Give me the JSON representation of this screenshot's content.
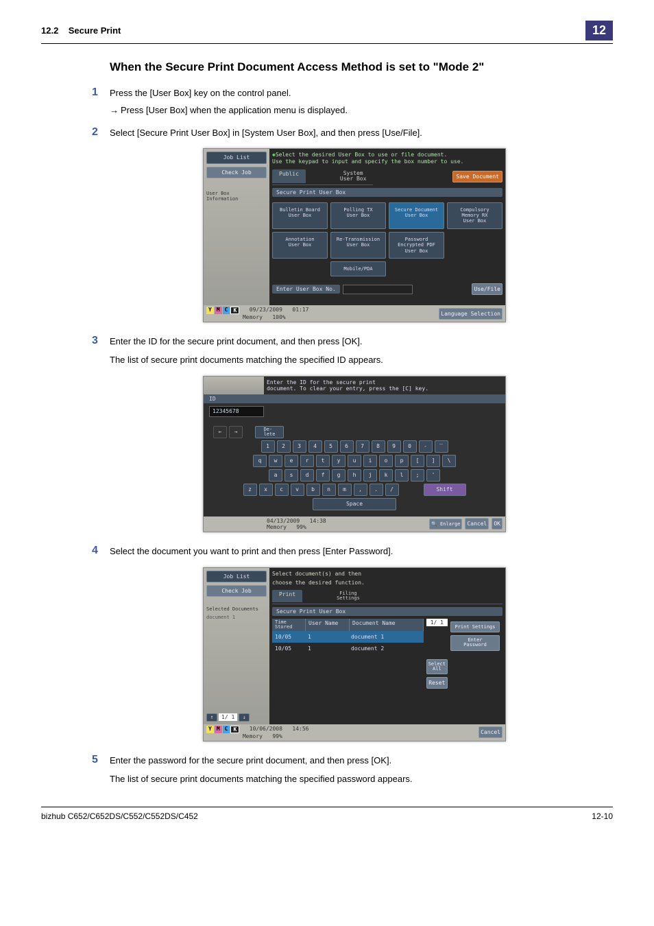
{
  "header": {
    "section_ref": "12.2",
    "section_title": "Secure Print",
    "chapter": "12"
  },
  "title": "When the Secure Print Document Access Method is set to \"Mode 2\"",
  "steps": {
    "s1": {
      "num": "1",
      "text": "Press the [User Box] key on the control panel.",
      "sub_arrow": "→",
      "sub": "Press [User Box] when the application menu is displayed."
    },
    "s2": {
      "num": "2",
      "text": "Select [Secure Print User Box] in [System User Box], and then press [Use/File]."
    },
    "s3": {
      "num": "3",
      "text": "Enter the ID for the secure print document, and then press [OK].",
      "text2": "The list of secure print documents matching the specified ID appears."
    },
    "s4": {
      "num": "4",
      "text": "Select the document you want to print and then press [Enter Password]."
    },
    "s5": {
      "num": "5",
      "text": "Enter the password for the secure print document, and then press [OK].",
      "text2": "The list of secure print documents matching the specified password appears."
    }
  },
  "ss1": {
    "sidebar": {
      "job_list": "Job List",
      "check_job": "Check Job",
      "userbox_info": "User Box\nInformation"
    },
    "msg1": "Select the desired User Box to use or file document.",
    "msg2": "Use the keypad to input and specify the box number to use.",
    "tab_public": "Public",
    "tab_system": "System\nUser Box",
    "save_doc": "Save Document",
    "bar": "Secure Print User Box",
    "cells": {
      "c1": "Bulletin Board\nUser Box",
      "c2": "Polling TX\nUser Box",
      "c3": "Secure Document\nUser Box",
      "c4": "Compulsory\nMemory RX\nUser Box",
      "c5": "Annotation\nUser Box",
      "c6": "Re-Transmission\nUser Box",
      "c7": "Password\nEncrypted PDF\nUser Box",
      "c8": "Mobile/PDA"
    },
    "enter_label": "Enter User Box No.",
    "use_file": "Use/File",
    "status_date": "09/23/2009",
    "status_time": "01:17",
    "status_mem": "Memory",
    "status_pct": "100%",
    "lang_sel": "Language Selection",
    "ymck": {
      "y": "Y",
      "m": "M",
      "c": "C",
      "k": "K"
    }
  },
  "ss2": {
    "msg1": "Enter the ID for the secure print",
    "msg2": "document. To clear your entry, press the [C] key.",
    "id_label": "ID",
    "id_value": "12345678",
    "delete": "De-\nlete",
    "space": "Space",
    "shift": "Shift",
    "enlarge": "Enlarge",
    "cancel": "Cancel",
    "ok": "OK",
    "status_date": "04/13/2009",
    "status_time": "14:38",
    "status_mem": "Memory",
    "status_pct": "99%",
    "rows": {
      "r1": [
        "1",
        "2",
        "3",
        "4",
        "5",
        "6",
        "7",
        "8",
        "9",
        "0",
        "-",
        "‾"
      ],
      "r2": [
        "q",
        "w",
        "e",
        "r",
        "t",
        "y",
        "u",
        "i",
        "o",
        "p",
        "[",
        "]",
        "\\"
      ],
      "r3": [
        "a",
        "s",
        "d",
        "f",
        "g",
        "h",
        "j",
        "k",
        "l",
        ";",
        "'"
      ],
      "r4": [
        "z",
        "x",
        "c",
        "v",
        "b",
        "n",
        "m",
        ",",
        ".",
        "/"
      ]
    }
  },
  "ss3": {
    "sidebar": {
      "job_list": "Job List",
      "check_job": "Check Job",
      "sel_docs": "Selected Documents",
      "doc1": "document 1",
      "pager": "1/ 1"
    },
    "msg1": "Select document(s) and then",
    "msg2": "choose the desired function.",
    "tab_print": "Print",
    "tab_filing": "Filing\nSettings",
    "bar": "Secure Print User Box",
    "headers": {
      "time": "Time\nStored",
      "user": "User Name",
      "doc": "Document Name"
    },
    "rows": [
      {
        "time": "10/05",
        "user": "1",
        "doc": "document 1"
      },
      {
        "time": "10/05",
        "user": "1",
        "doc": "document 2"
      }
    ],
    "page_ind": "1/ 1",
    "print_settings": "Print Settings",
    "enter_password": "Enter\nPassword",
    "select_all": "Select\nAll",
    "reset": "Reset",
    "cancel": "Cancel",
    "status_date": "10/06/2008",
    "status_time": "14:56",
    "status_mem": "Memory",
    "status_pct": "99%"
  },
  "footer": {
    "model": "bizhub C652/C652DS/C552/C552DS/C452",
    "page": "12-10"
  }
}
